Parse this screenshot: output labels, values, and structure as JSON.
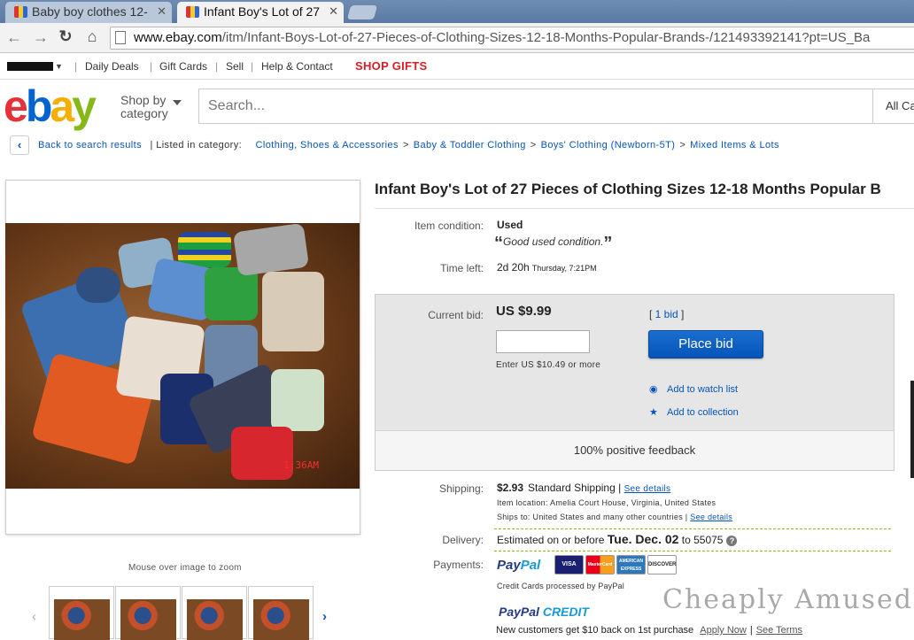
{
  "browser": {
    "tabs": [
      {
        "title": "Baby boy clothes 12-"
      },
      {
        "title": "Infant Boy's Lot of 27"
      }
    ],
    "url_host": "www.ebay.com",
    "url_path": "/itm/Infant-Boys-Lot-of-27-Pieces-of-Clothing-Sizes-12-18-Months-Popular-Brands-/121493392141?pt=US_Ba"
  },
  "topbar": {
    "links": [
      "Daily Deals",
      "Gift Cards",
      "Sell",
      "Help & Contact"
    ],
    "promo": "SHOP GIFTS"
  },
  "header": {
    "logo": {
      "e": "e",
      "b": "b",
      "a": "a",
      "y": "y"
    },
    "shop_by": "Shop by",
    "category": "category",
    "search_placeholder": "Search...",
    "all_categories": "All Ca"
  },
  "breadcrumb": {
    "back": "Back to search results",
    "listed_in": "| Listed in category:",
    "path": [
      "Clothing, Shoes & Accessories",
      "Baby & Toddler Clothing",
      "Boys' Clothing (Newborn-5T)",
      "Mixed Items & Lots"
    ]
  },
  "gallery": {
    "timestamp": "1:36AM",
    "zoom_hint": "Mouse over image to zoom"
  },
  "item": {
    "title": "Infant Boy's Lot of 27 Pieces of Clothing Sizes 12-18 Months Popular B",
    "condition_label": "Item condition:",
    "condition": "Used",
    "condition_note": "Good used condition.",
    "time_label": "Time left:",
    "time_left": "2d 20h",
    "time_end": "Thursday, 7:21PM"
  },
  "bid": {
    "label": "Current bid:",
    "price": "US $9.99",
    "hint": "Enter US $10.49 or more",
    "bid_count": "1 bid",
    "button": "Place bid",
    "watch": "Add to watch list",
    "collection": "Add to collection",
    "feedback": "100% positive feedback"
  },
  "shipping": {
    "label": "Shipping:",
    "cost": "$2.93",
    "method": "Standard Shipping |",
    "details": "See details",
    "location": "Item location:  Amelia Court House, Virginia, United States",
    "ships_to": "Ships to:  United States and many other countries |",
    "ships_details": "See details"
  },
  "delivery": {
    "label": "Delivery:",
    "prefix": "Estimated on or before",
    "date": "Tue. Dec. 02",
    "suffix": "to 55075"
  },
  "payments": {
    "label": "Payments:",
    "paypal_a": "Pay",
    "paypal_b": "Pal",
    "cards": [
      "VISA",
      "MasterCard",
      "AMERICAN EXPRESS",
      "DISCOVER"
    ],
    "card_note": "Credit Cards processed by PayPal",
    "credit_a": "PayPal",
    "credit_b": " CREDIT",
    "offer": "New customers get $10 back on 1st purchase",
    "apply": "Apply Now",
    "terms": "See Terms"
  },
  "watermark": "Cheaply Amused",
  "colors": {
    "link": "#0654ba",
    "button": "#0654ba",
    "promo": "#d71f26",
    "dashed_rule": "#86b817"
  }
}
